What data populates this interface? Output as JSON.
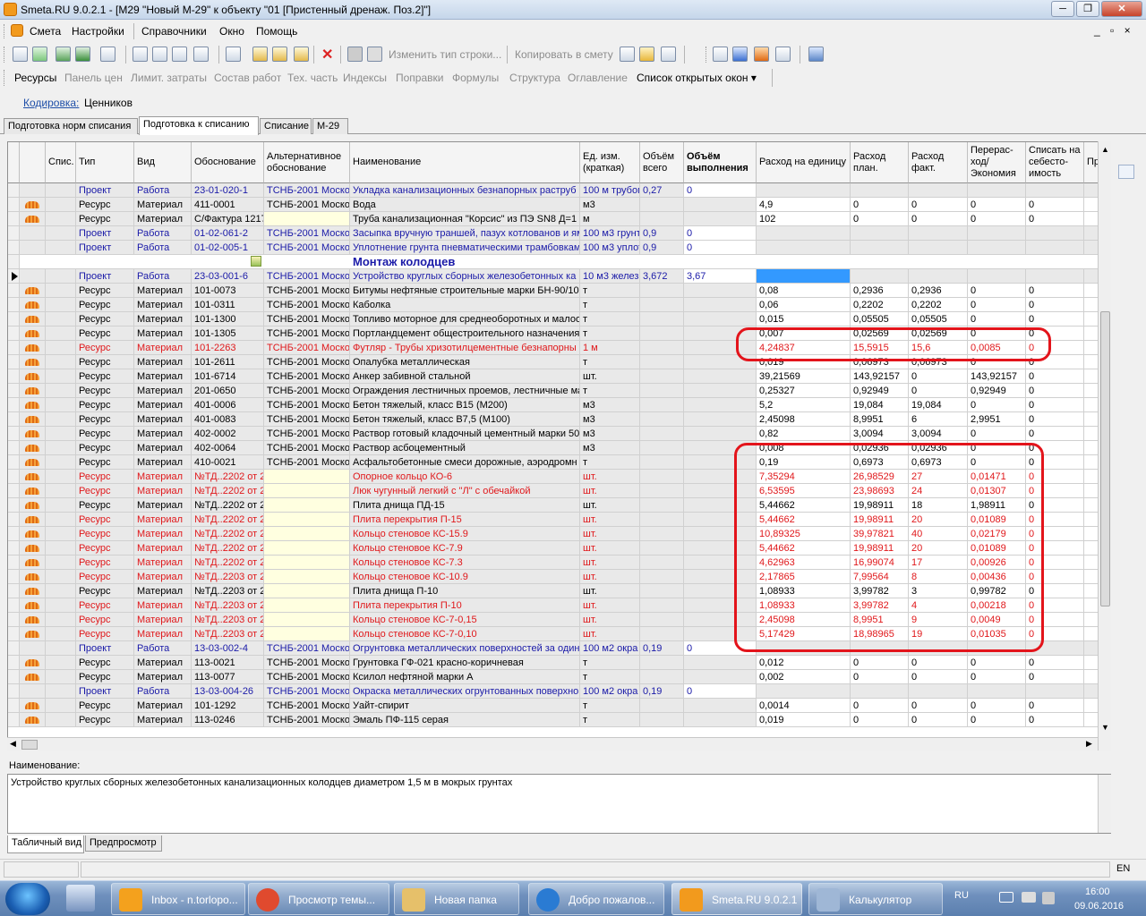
{
  "window": {
    "title": "Smeta.RU  9.0.2.1   - [M29 \"Новый М-29\" к объекту \"01 [Пристенный дренаж. Поз.2]\"]",
    "min_glyph": "─",
    "restore_glyph": "❐",
    "close_glyph": "✕",
    "mdi_controls": "_ ▫ ×"
  },
  "menu": [
    "Смета",
    "Настройки",
    "Справочники",
    "Окно",
    "Помощь"
  ],
  "toolbar1": {
    "change_row_type": "Изменить тип строки...",
    "copy_to_estimate": "Копировать в смету"
  },
  "toolbar2": [
    "Ресурсы",
    "Панель цен",
    "Лимит. затраты",
    "Состав работ",
    "Тех. часть",
    "Индексы",
    "Поправки",
    "Формулы",
    "Структура",
    "Оглавление",
    "Список открытых окон ▾"
  ],
  "coding": {
    "label": "Кодировка:",
    "value": "Ценников"
  },
  "tabs": [
    "Подготовка норм списания",
    "Подготовка к списанию",
    "Списание",
    "М-29"
  ],
  "columns": [
    "Спис.",
    "Тип",
    "Вид",
    "Обоснование",
    "Альтернативное обоснование",
    "Наименование",
    "Ед. изм. (краткая)",
    "Объём всего",
    "Объём выполнения",
    "Расход на единицу",
    "Расход план.",
    "Расход факт.",
    "Перерас-ход/ Экономия",
    "Списать на себесто-имость",
    "Пр"
  ],
  "rows": [
    {
      "kind": "proj",
      "type": "Проект",
      "vid": "Работа",
      "obos": "23-01-020-1",
      "alt": "ТСНБ-2001 Моско",
      "name": "Укладка канализационных безнапорных раструб",
      "unit": "100 м трубоп",
      "vtot": "0,27",
      "vexe": "0",
      "rate": "",
      "plan": "",
      "fact": "",
      "diff": "",
      "write": ""
    },
    {
      "kind": "res",
      "type": "Ресурс",
      "vid": "Материал",
      "obos": "411-0001",
      "alt": "ТСНБ-2001 Моско",
      "name": "Вода",
      "unit": "м3",
      "vtot": "",
      "vexe": "",
      "rate": "4,9",
      "plan": "0",
      "fact": "0",
      "diff": "0",
      "write": "0"
    },
    {
      "kind": "resy",
      "type": "Ресурс",
      "vid": "Материал",
      "obos": "С/Фактура 1217",
      "alt": "",
      "name": "Труба канализационная \"Корсис\" из ПЭ SN8 Д=1",
      "unit": "м",
      "vtot": "",
      "vexe": "",
      "rate": "102",
      "plan": "0",
      "fact": "0",
      "diff": "0",
      "write": "0"
    },
    {
      "kind": "proj",
      "type": "Проект",
      "vid": "Работа",
      "obos": "01-02-061-2",
      "alt": "ТСНБ-2001 Моско",
      "name": "Засыпка вручную траншей, пазух котлованов и ям",
      "unit": "100 м3 грунт",
      "vtot": "0,9",
      "vexe": "0",
      "rate": "",
      "plan": "",
      "fact": "",
      "diff": "",
      "write": ""
    },
    {
      "kind": "proj",
      "type": "Проект",
      "vid": "Работа",
      "obos": "01-02-005-1",
      "alt": "ТСНБ-2001 Моско",
      "name": "Уплотнение грунта пневматическими трамбовкам",
      "unit": "100 м3 уплот",
      "vtot": "0,9",
      "vexe": "0",
      "rate": "",
      "plan": "",
      "fact": "",
      "diff": "",
      "write": ""
    },
    {
      "kind": "section",
      "name": "Монтаж колодцев"
    },
    {
      "kind": "projsel",
      "type": "Проект",
      "vid": "Работа",
      "obos": "23-03-001-6",
      "alt": "ТСНБ-2001 Моско",
      "name": "Устройство круглых сборных железобетонных ка",
      "unit": "10 м3 желез",
      "vtot": "3,672",
      "vexe": "3,67",
      "rate": "",
      "plan": "",
      "fact": "",
      "diff": "",
      "write": ""
    },
    {
      "kind": "res",
      "type": "Ресурс",
      "vid": "Материал",
      "obos": "101-0073",
      "alt": "ТСНБ-2001 Моско",
      "name": "Битумы нефтяные строительные марки БН-90/10",
      "unit": "т",
      "vtot": "",
      "vexe": "",
      "rate": "0,08",
      "plan": "0,2936",
      "fact": "0,2936",
      "diff": "0",
      "write": "0"
    },
    {
      "kind": "res",
      "type": "Ресурс",
      "vid": "Материал",
      "obos": "101-0311",
      "alt": "ТСНБ-2001 Моско",
      "name": "Каболка",
      "unit": "т",
      "vtot": "",
      "vexe": "",
      "rate": "0,06",
      "plan": "0,2202",
      "fact": "0,2202",
      "diff": "0",
      "write": "0"
    },
    {
      "kind": "res",
      "type": "Ресурс",
      "vid": "Материал",
      "obos": "101-1300",
      "alt": "ТСНБ-2001 Моско",
      "name": "Топливо моторное для среднеоборотных и малоо",
      "unit": "т",
      "vtot": "",
      "vexe": "",
      "rate": "0,015",
      "plan": "0,05505",
      "fact": "0,05505",
      "diff": "0",
      "write": "0"
    },
    {
      "kind": "res",
      "type": "Ресурс",
      "vid": "Материал",
      "obos": "101-1305",
      "alt": "ТСНБ-2001 Моско",
      "name": "Портландцемент общестроительного назначения",
      "unit": "т",
      "vtot": "",
      "vexe": "",
      "rate": "0,007",
      "plan": "0,02569",
      "fact": "0,02569",
      "diff": "0",
      "write": "0"
    },
    {
      "kind": "red",
      "type": "Ресурс",
      "vid": "Материал",
      "obos": "101-2263",
      "alt": "ТСНБ-2001 Моско",
      "name": "Футляр - Трубы хризотилцементные безнапорны",
      "unit": "1 м",
      "vtot": "",
      "vexe": "",
      "rate": "4,24837",
      "plan": "15,5915",
      "fact": "15,6",
      "diff": "0,0085",
      "write": "0"
    },
    {
      "kind": "res",
      "type": "Ресурс",
      "vid": "Материал",
      "obos": "101-2611",
      "alt": "ТСНБ-2001 Моско",
      "name": "Опалубка металлическая",
      "unit": "т",
      "vtot": "",
      "vexe": "",
      "rate": "0,019",
      "plan": "0,06973",
      "fact": "0,06973",
      "diff": "0",
      "write": "0"
    },
    {
      "kind": "res",
      "type": "Ресурс",
      "vid": "Материал",
      "obos": "101-6714",
      "alt": "ТСНБ-2001 Моско",
      "name": "Анкер забивной стальной",
      "unit": "шт.",
      "vtot": "",
      "vexe": "",
      "rate": "39,21569",
      "plan": "143,92157",
      "fact": "0",
      "diff": "143,92157",
      "write": "0"
    },
    {
      "kind": "res",
      "type": "Ресурс",
      "vid": "Материал",
      "obos": "201-0650",
      "alt": "ТСНБ-2001 Моско",
      "name": "Ограждения лестничных проемов, лестничные ма",
      "unit": "т",
      "vtot": "",
      "vexe": "",
      "rate": "0,25327",
      "plan": "0,92949",
      "fact": "0",
      "diff": "0,92949",
      "write": "0"
    },
    {
      "kind": "res",
      "type": "Ресурс",
      "vid": "Материал",
      "obos": "401-0006",
      "alt": "ТСНБ-2001 Моско",
      "name": "Бетон тяжелый, класс В15 (М200)",
      "unit": "м3",
      "vtot": "",
      "vexe": "",
      "rate": "5,2",
      "plan": "19,084",
      "fact": "19,084",
      "diff": "0",
      "write": "0"
    },
    {
      "kind": "res",
      "type": "Ресурс",
      "vid": "Материал",
      "obos": "401-0083",
      "alt": "ТСНБ-2001 Моско",
      "name": "Бетон тяжелый, класс В7,5 (М100)",
      "unit": "м3",
      "vtot": "",
      "vexe": "",
      "rate": "2,45098",
      "plan": "8,9951",
      "fact": "6",
      "diff": "2,9951",
      "write": "0"
    },
    {
      "kind": "res",
      "type": "Ресурс",
      "vid": "Материал",
      "obos": "402-0002",
      "alt": "ТСНБ-2001 Моско",
      "name": "Раствор готовый кладочный цементный марки 50",
      "unit": "м3",
      "vtot": "",
      "vexe": "",
      "rate": "0,82",
      "plan": "3,0094",
      "fact": "3,0094",
      "diff": "0",
      "write": "0"
    },
    {
      "kind": "res",
      "type": "Ресурс",
      "vid": "Материал",
      "obos": "402-0064",
      "alt": "ТСНБ-2001 Моско",
      "name": "Раствор асбоцементный",
      "unit": "м3",
      "vtot": "",
      "vexe": "",
      "rate": "0,008",
      "plan": "0,02936",
      "fact": "0,02936",
      "diff": "0",
      "write": "0"
    },
    {
      "kind": "res",
      "type": "Ресурс",
      "vid": "Материал",
      "obos": "410-0021",
      "alt": "ТСНБ-2001 Моско",
      "name": "Асфальтобетонные смеси дорожные, аэродромн",
      "unit": "т",
      "vtot": "",
      "vexe": "",
      "rate": "0,19",
      "plan": "0,6973",
      "fact": "0,6973",
      "diff": "0",
      "write": "0"
    },
    {
      "kind": "redy",
      "type": "Ресурс",
      "vid": "Материал",
      "obos": "№ТД..2202 от 2",
      "alt": "",
      "name": "Опорное кольцо КО-6",
      "unit": "шт.",
      "vtot": "",
      "vexe": "",
      "rate": "7,35294",
      "plan": "26,98529",
      "fact": "27",
      "diff": "0,01471",
      "write": "0"
    },
    {
      "kind": "redy",
      "type": "Ресурс",
      "vid": "Материал",
      "obos": "№ТД..2202 от 2",
      "alt": "",
      "name": "Люк чугунный легкий с \"Л\" с обечайкой",
      "unit": "шт.",
      "vtot": "",
      "vexe": "",
      "rate": "6,53595",
      "plan": "23,98693",
      "fact": "24",
      "diff": "0,01307",
      "write": "0"
    },
    {
      "kind": "resy",
      "type": "Ресурс",
      "vid": "Материал",
      "obos": "№ТД..2202 от 2",
      "alt": "",
      "name": "Плита днища ПД-15",
      "unit": "шт.",
      "vtot": "",
      "vexe": "",
      "rate": "5,44662",
      "plan": "19,98911",
      "fact": "18",
      "diff": "1,98911",
      "write": "0"
    },
    {
      "kind": "redy",
      "type": "Ресурс",
      "vid": "Материал",
      "obos": "№ТД..2202 от 2",
      "alt": "",
      "name": "Плита перекрытия П-15",
      "unit": "шт.",
      "vtot": "",
      "vexe": "",
      "rate": "5,44662",
      "plan": "19,98911",
      "fact": "20",
      "diff": "0,01089",
      "write": "0"
    },
    {
      "kind": "redy",
      "type": "Ресурс",
      "vid": "Материал",
      "obos": "№ТД..2202 от 2",
      "alt": "",
      "name": "Кольцо стеновое КС-15.9",
      "unit": "шт.",
      "vtot": "",
      "vexe": "",
      "rate": "10,89325",
      "plan": "39,97821",
      "fact": "40",
      "diff": "0,02179",
      "write": "0"
    },
    {
      "kind": "redy",
      "type": "Ресурс",
      "vid": "Материал",
      "obos": "№ТД..2202 от 2",
      "alt": "",
      "name": "Кольцо стеновое КС-7.9",
      "unit": "шт.",
      "vtot": "",
      "vexe": "",
      "rate": "5,44662",
      "plan": "19,98911",
      "fact": "20",
      "diff": "0,01089",
      "write": "0"
    },
    {
      "kind": "redy",
      "type": "Ресурс",
      "vid": "Материал",
      "obos": "№ТД..2202 от 2",
      "alt": "",
      "name": "Кольцо стеновое КС-7.3",
      "unit": "шт.",
      "vtot": "",
      "vexe": "",
      "rate": "4,62963",
      "plan": "16,99074",
      "fact": "17",
      "diff": "0,00926",
      "write": "0"
    },
    {
      "kind": "redy",
      "type": "Ресурс",
      "vid": "Материал",
      "obos": "№ТД..2203 от 2",
      "alt": "",
      "name": "Кольцо стеновое КС-10.9",
      "unit": "шт.",
      "vtot": "",
      "vexe": "",
      "rate": "2,17865",
      "plan": "7,99564",
      "fact": "8",
      "diff": "0,00436",
      "write": "0"
    },
    {
      "kind": "resy",
      "type": "Ресурс",
      "vid": "Материал",
      "obos": "№ТД..2203 от 2",
      "alt": "",
      "name": "Плита днища П-10",
      "unit": "шт.",
      "vtot": "",
      "vexe": "",
      "rate": "1,08933",
      "plan": "3,99782",
      "fact": "3",
      "diff": "0,99782",
      "write": "0"
    },
    {
      "kind": "redy",
      "type": "Ресурс",
      "vid": "Материал",
      "obos": "№ТД..2203 от 2",
      "alt": "",
      "name": "Плита перекрытия П-10",
      "unit": "шт.",
      "vtot": "",
      "vexe": "",
      "rate": "1,08933",
      "plan": "3,99782",
      "fact": "4",
      "diff": "0,00218",
      "write": "0"
    },
    {
      "kind": "redy",
      "type": "Ресурс",
      "vid": "Материал",
      "obos": "№ТД..2203 от 2",
      "alt": "",
      "name": "Кольцо стеновое КС-7-0,15",
      "unit": "шт.",
      "vtot": "",
      "vexe": "",
      "rate": "2,45098",
      "plan": "8,9951",
      "fact": "9",
      "diff": "0,0049",
      "write": "0"
    },
    {
      "kind": "redy",
      "type": "Ресурс",
      "vid": "Материал",
      "obos": "№ТД..2203 от 2",
      "alt": "",
      "name": "Кольцо стеновое КС-7-0,10",
      "unit": "шт.",
      "vtot": "",
      "vexe": "",
      "rate": "5,17429",
      "plan": "18,98965",
      "fact": "19",
      "diff": "0,01035",
      "write": "0"
    },
    {
      "kind": "proj",
      "type": "Проект",
      "vid": "Работа",
      "obos": "13-03-002-4",
      "alt": "ТСНБ-2001 Моско",
      "name": "Огрунтовка металлических поверхностей за один",
      "unit": "100 м2 окра",
      "vtot": "0,19",
      "vexe": "0",
      "rate": "",
      "plan": "",
      "fact": "",
      "diff": "",
      "write": ""
    },
    {
      "kind": "res",
      "type": "Ресурс",
      "vid": "Материал",
      "obos": "113-0021",
      "alt": "ТСНБ-2001 Моско",
      "name": "Грунтовка ГФ-021 красно-коричневая",
      "unit": "т",
      "vtot": "",
      "vexe": "",
      "rate": "0,012",
      "plan": "0",
      "fact": "0",
      "diff": "0",
      "write": "0"
    },
    {
      "kind": "res",
      "type": "Ресурс",
      "vid": "Материал",
      "obos": "113-0077",
      "alt": "ТСНБ-2001 Моско",
      "name": "Ксилол нефтяной марки А",
      "unit": "т",
      "vtot": "",
      "vexe": "",
      "rate": "0,002",
      "plan": "0",
      "fact": "0",
      "diff": "0",
      "write": "0"
    },
    {
      "kind": "proj",
      "type": "Проект",
      "vid": "Работа",
      "obos": "13-03-004-26",
      "alt": "ТСНБ-2001 Моско",
      "name": "Окраска металлических огрунтованных поверхно",
      "unit": "100 м2 окра",
      "vtot": "0,19",
      "vexe": "0",
      "rate": "",
      "plan": "",
      "fact": "",
      "diff": "",
      "write": ""
    },
    {
      "kind": "res",
      "type": "Ресурс",
      "vid": "Материал",
      "obos": "101-1292",
      "alt": "ТСНБ-2001 Моско",
      "name": "Уайт-спирит",
      "unit": "т",
      "vtot": "",
      "vexe": "",
      "rate": "0,0014",
      "plan": "0",
      "fact": "0",
      "diff": "0",
      "write": "0"
    },
    {
      "kind": "res",
      "type": "Ресурс",
      "vid": "Материал",
      "obos": "113-0246",
      "alt": "ТСНБ-2001 Моско",
      "name": "Эмаль ПФ-115 серая",
      "unit": "т",
      "vtot": "",
      "vexe": "",
      "rate": "0,019",
      "plan": "0",
      "fact": "0",
      "diff": "0",
      "write": "0"
    }
  ],
  "description": {
    "label": "Наименование:",
    "text": "Устройство круглых сборных железобетонных канализационных колодцев диаметром 1,5 м в мокрых грунтах"
  },
  "bottom_tabs": [
    "Табличный вид",
    "Предпросмотр"
  ],
  "status": {
    "lang": "EN"
  },
  "taskbar": {
    "items": [
      "Inbox - n.torlopo...",
      "Просмотр темы...",
      "Новая папка",
      "Добро пожалов...",
      "Smeta.RU  9.0.2.1",
      "Калькулятор"
    ],
    "lang": "RU",
    "time": "16:00",
    "date": "09.06.2016"
  },
  "colors": {
    "project_text": "#1a1aa8",
    "highlight_red": "#e0181b",
    "selection_blue": "#3399ff",
    "alt_yellow": "#ffffe0"
  }
}
